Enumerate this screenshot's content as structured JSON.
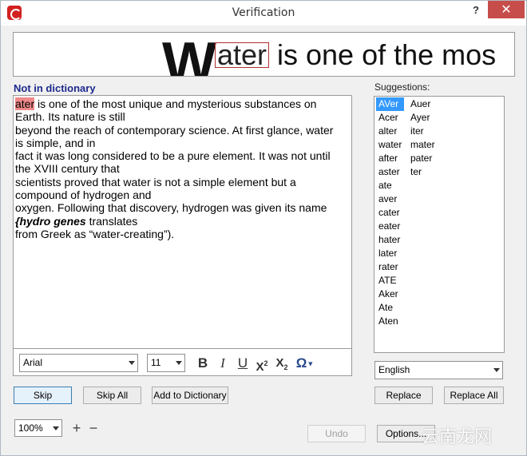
{
  "window": {
    "title": "Verification",
    "help_label": "?",
    "close_label": "✕"
  },
  "preview": {
    "big_letter": "W",
    "error_word": "ater",
    "rest_text": " is one of the mos"
  },
  "error_heading": "Not in dictionary",
  "editor": {
    "error_word": "ater",
    "lines": [
      " is one of the most unique and mysterious substances on Earth. Its nature is still",
      "beyond the reach of contemporary science. At first glance, water is simple, and in",
      "fact it was long considered to be a pure element. It was not until the XVIII century that",
      "scientists proved that water is not a simple element but a compound of hydrogen and",
      "oxygen. Following that discovery, hydrogen was given its name "
    ],
    "emphasis": "{hydro genes",
    "after_emphasis": " translates",
    "last_line": "from Greek as “water-creating”)."
  },
  "format_bar": {
    "font_value": "Arial",
    "size_value": "11",
    "bold": "B",
    "italic": "I",
    "underline": "U",
    "superscript": "X",
    "superscript_mark": "2",
    "subscript": "X",
    "subscript_mark": "2",
    "symbol": "Ω"
  },
  "suggestions": {
    "label": "Suggestions:",
    "col1": [
      "AVer",
      "Acer",
      "alter",
      "water",
      "after",
      "aster",
      "ate",
      "aver",
      "cater",
      "eater",
      "hater",
      "later",
      "rater",
      "ATE",
      "Aker",
      "Ate",
      "Aten"
    ],
    "col2": [
      "Auer",
      "Ayer",
      "iter",
      "mater",
      "pater",
      "ter"
    ],
    "selected": "AVer",
    "language": "English"
  },
  "buttons": {
    "skip": "Skip",
    "skip_all": "Skip All",
    "add_dict": "Add to Dictionary",
    "replace": "Replace",
    "replace_all": "Replace All",
    "undo": "Undo",
    "options": "Options..."
  },
  "zoom": {
    "value": "100%",
    "plus": "+",
    "minus": "−"
  },
  "watermark": "云南龙网",
  "colors": {
    "accent": "#3399ff",
    "error_highlight": "#ef8a8a",
    "heading": "#1d2a8c"
  }
}
